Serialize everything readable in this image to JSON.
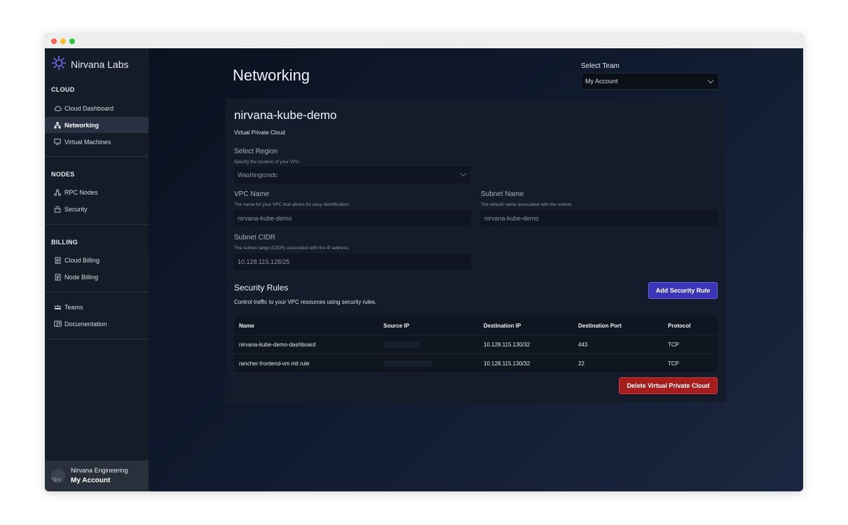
{
  "sidebar": {
    "brand": "Nirvana Labs",
    "sections": [
      {
        "title": "CLOUD",
        "items": [
          {
            "label": "Cloud Dashboard",
            "icon": "cloud-icon"
          },
          {
            "label": "Networking",
            "icon": "network-icon",
            "active": true
          },
          {
            "label": "Virtual Machines",
            "icon": "monitor-icon"
          }
        ]
      },
      {
        "title": "NODES",
        "items": [
          {
            "label": "RPC Nodes",
            "icon": "nodes-icon"
          },
          {
            "label": "Security",
            "icon": "lock-icon"
          }
        ]
      },
      {
        "title": "BILLING",
        "items": [
          {
            "label": "Cloud Billing",
            "icon": "receipt-icon"
          },
          {
            "label": "Node Billing",
            "icon": "receipt-icon"
          }
        ]
      },
      {
        "title": "",
        "items": [
          {
            "label": "Teams",
            "icon": "team-icon"
          },
          {
            "label": "Documentation",
            "icon": "book-icon"
          }
        ]
      }
    ],
    "user": {
      "avatar_text": "Nirv",
      "name": "Nirvana Engineering",
      "account": "My Account"
    }
  },
  "header": {
    "title": "Networking",
    "team_label": "Select Team",
    "team_value": "My Account"
  },
  "vpc": {
    "name": "nirvana-kube-demo",
    "subtitle": "Virtual Private Cloud",
    "region": {
      "label": "Select Region",
      "help": "Specify the location of your VPC.",
      "value": "Washingtondc"
    },
    "vpc_name": {
      "label": "VPC Name",
      "help": "The name for your VPC that allows for easy identification.",
      "value": "nirvana-kube-demo"
    },
    "subnet_name": {
      "label": "Subnet Name",
      "help": "The default name associated with the subnet.",
      "value": "nirvana-kube-demo"
    },
    "subnet_cidr": {
      "label": "Subnet CIDR",
      "help": "The subnet range (CIDR) associated with the IP address.",
      "value": "10.128.115.128/25"
    }
  },
  "security": {
    "title": "Security Rules",
    "description": "Control traffic to your VPC resources using security rules.",
    "add_label": "Add Security Rule",
    "columns": [
      "Name",
      "Source IP",
      "Destination IP",
      "Destination Port",
      "Protocol"
    ],
    "rows": [
      {
        "name": "nirvana-kube-demo-dashboard",
        "source_ip": "",
        "destination_ip": "10.128.115.130/32",
        "destination_port": "443",
        "protocol": "TCP"
      },
      {
        "name": "rancher-frontend-vm init rule",
        "source_ip": "",
        "destination_ip": "10.128.115.130/32",
        "destination_port": "22",
        "protocol": "TCP"
      }
    ],
    "delete_label": "Delete Virtual Private Cloud"
  },
  "colors": {
    "accent": "#3b35b8",
    "danger": "#a51d1d",
    "sidebar_bg": "#151c28",
    "card_bg": "#141c2b"
  }
}
